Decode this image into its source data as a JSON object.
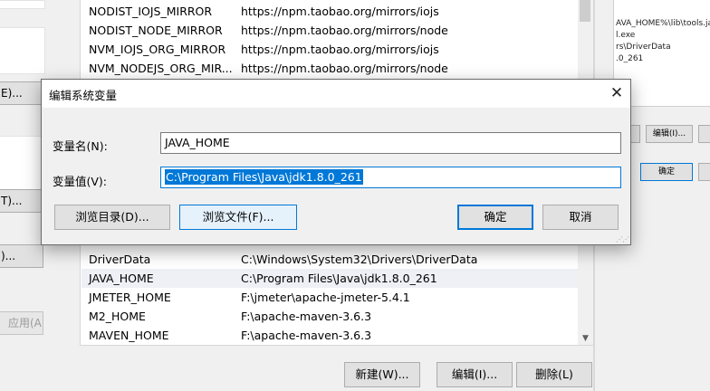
{
  "left_bg": {
    "buttons": [
      "E)...",
      "T)...",
      ")...",
      "应用(A)"
    ]
  },
  "right_bg": {
    "list_rows": [
      "AVA_HOME%\\lib\\tools.jar",
      "l.exe",
      "rs\\DriverData",
      ".0_261"
    ],
    "buttons": [
      "编辑(I)...",
      "",
      "确定",
      ""
    ]
  },
  "env_list": {
    "rows_top": [
      {
        "name": "NODIST_IOJS_MIRROR",
        "value": "https://npm.taobao.org/mirrors/iojs"
      },
      {
        "name": "NODIST_NODE_MIRROR",
        "value": "https://npm.taobao.org/mirrors/node"
      },
      {
        "name": "NVM_IOJS_ORG_MIRROR",
        "value": "https://npm.taobao.org/mirrors/iojs"
      },
      {
        "name": "NVM_NODEJS_ORG_MIR...",
        "value": "https://npm.taobao.org/mirrors/node"
      }
    ],
    "rows_bottom": [
      {
        "name": "DriverData",
        "value": "C:\\Windows\\System32\\Drivers\\DriverData"
      },
      {
        "name": "JAVA_HOME",
        "value": "C:\\Program Files\\Java\\jdk1.8.0_261"
      },
      {
        "name": "JMETER_HOME",
        "value": "F:\\jmeter\\apache-jmeter-5.4.1"
      },
      {
        "name": "M2_HOME",
        "value": "F:\\apache-maven-3.6.3"
      },
      {
        "name": "MAVEN_HOME",
        "value": "F:\\apache-maven-3.6.3"
      }
    ],
    "buttons": {
      "new": "新建(W)...",
      "edit": "编辑(I)...",
      "delete": "删除(L)"
    }
  },
  "dialog": {
    "title": "编辑系统变量",
    "close_glyph": "✕",
    "name_label": "变量名(N):",
    "name_value": "JAVA_HOME",
    "value_label": "变量值(V):",
    "value_value": "C:\\Program Files\\Java\\jdk1.8.0_261",
    "browse_dir": "浏览目录(D)...",
    "browse_file": "浏览文件(F)...",
    "ok": "确定",
    "cancel": "取消"
  },
  "colors": {
    "accent": "#0078d7",
    "selection_row": "#eef0f5"
  }
}
